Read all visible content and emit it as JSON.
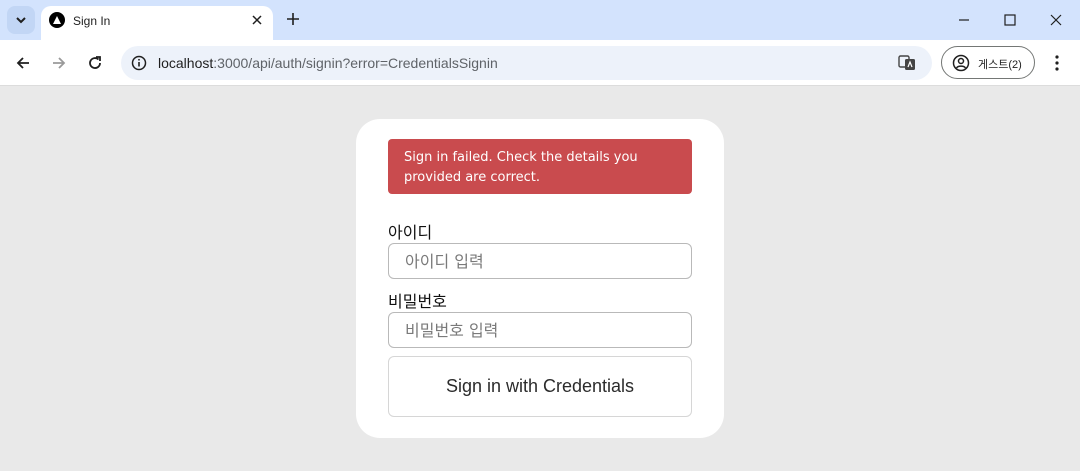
{
  "browser": {
    "tab_title": "Sign In",
    "url_host": "localhost",
    "url_rest": ":3000/api/auth/signin?error=CredentialsSignin",
    "profile_label": "게스트(2)",
    "icons": [
      "tab-search-icon",
      "close-icon",
      "plus-icon",
      "minimize-icon",
      "maximize-icon",
      "close-window-icon",
      "back-icon",
      "forward-icon",
      "reload-icon",
      "info-icon",
      "translate-icon",
      "profile-icon",
      "more-icon"
    ]
  },
  "signin": {
    "error_message": "Sign in failed. Check the details you provided are correct.",
    "username_label": "아이디",
    "username_placeholder": "아이디 입력",
    "password_label": "비밀번호",
    "password_placeholder": "비밀번호 입력",
    "submit_label": "Sign in with Credentials"
  },
  "colors": {
    "error_bg": "#c94b4e",
    "page_bg": "#e9e9e9",
    "titlebar_bg": "#d3e3fd"
  }
}
